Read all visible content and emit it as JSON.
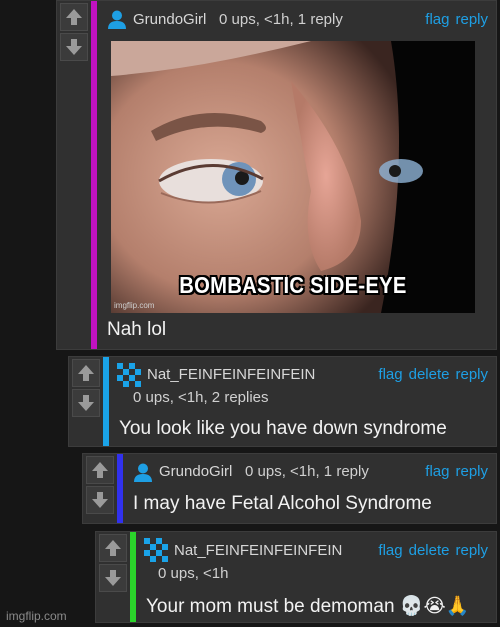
{
  "comments": [
    {
      "username": "GrundoGirl",
      "meta": "0 ups, <1h, 1 reply",
      "actions": [
        "flag",
        "reply"
      ],
      "image_caption": "BOMBASTIC SIDE-EYE",
      "image_watermark": "imgflip.com",
      "text": "Nah lol",
      "bar_color": "#c012c0"
    },
    {
      "username": "Nat_FEINFEINFEINFEIN",
      "meta": "0 ups, <1h, 2 replies",
      "actions": [
        "flag",
        "delete",
        "reply"
      ],
      "text": "You look like you have down syndrome",
      "bar_color": "#1aa3e8"
    },
    {
      "username": "GrundoGirl",
      "meta": "0 ups, <1h, 1 reply",
      "actions": [
        "flag",
        "reply"
      ],
      "text": "I may have Fetal Alcohol Syndrome",
      "bar_color": "#3131ee"
    },
    {
      "username": "Nat_FEINFEINFEINFEIN",
      "meta": "0 ups, <1h",
      "actions": [
        "flag",
        "delete",
        "reply"
      ],
      "text": "Your mom must be demoman 💀😭🙏",
      "bar_color": "#2bd42b"
    }
  ],
  "watermark": "imgflip.com",
  "colors": {
    "background": "#161616",
    "card": "#303030",
    "link": "#1e9fe4"
  },
  "icons": [
    "upvote-arrow-icon",
    "downvote-arrow-icon",
    "user-avatar-icon",
    "pixel-avatar-icon",
    "skull-emoji",
    "crying-emoji",
    "praying-hands-emoji"
  ]
}
